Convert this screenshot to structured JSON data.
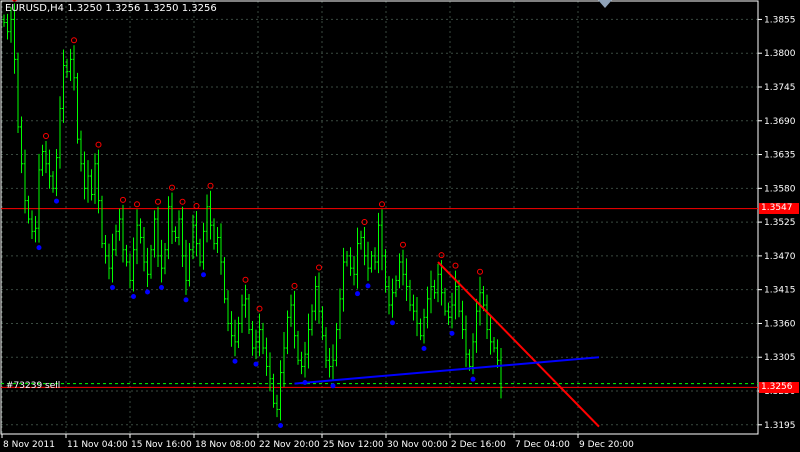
{
  "window": {
    "title": "EURUSD,H4  1.3250 1.3256 1.3250 1.3256",
    "order_label": "#73239 sell"
  },
  "colors": {
    "background": "#000000",
    "grid": "#3a4a40",
    "axis": "#ffffff",
    "candle": "#00ff00",
    "fractal_up": "#ff0000",
    "fractal_down": "#0000ff",
    "hline": "#ff0000",
    "trend_down": "#ff0000",
    "trend_up": "#0000ff",
    "order_line": "#00ff00"
  },
  "chart_data": {
    "type": "candlestick",
    "symbol": "EURUSD",
    "timeframe": "H4",
    "ohlc_header": "1.3250 1.3256 1.3250 1.3256",
    "ylim": [
      1.318,
      1.3885
    ],
    "y_ticks": [
      "1.3855",
      "1.3800",
      "1.3745",
      "1.3690",
      "1.3635",
      "1.3580",
      "1.3525",
      "1.3470",
      "1.3415",
      "1.3360",
      "1.3305",
      "1.3250",
      "1.3195"
    ],
    "x_ticks": [
      "8 Nov 2011",
      "11 Nov 04:00",
      "15 Nov 16:00",
      "18 Nov 08:00",
      "22 Nov 20:00",
      "25 Nov 12:00",
      "30 Nov 00:00",
      "2 Dec 16:00",
      "7 Dec 04:00",
      "9 Dec 20:00"
    ],
    "closes": [
      1.385,
      1.3835,
      1.3855,
      1.379,
      1.368,
      1.362,
      1.356,
      1.353,
      1.351,
      1.3515,
      1.361,
      1.364,
      1.362,
      1.36,
      1.358,
      1.363,
      1.371,
      1.378,
      1.377,
      1.379,
      1.376,
      1.366,
      1.362,
      1.358,
      1.36,
      1.357,
      1.362,
      1.356,
      1.349,
      1.347,
      1.345,
      1.348,
      1.351,
      1.353,
      1.348,
      1.346,
      1.343,
      1.348,
      1.352,
      1.35,
      1.346,
      1.344,
      1.348,
      1.353,
      1.347,
      1.345,
      1.348,
      1.355,
      1.351,
      1.35,
      1.353,
      1.347,
      1.343,
      1.348,
      1.352,
      1.349,
      1.346,
      1.351,
      1.355,
      1.352,
      1.349,
      1.35,
      1.346,
      1.34,
      1.336,
      1.334,
      1.333,
      1.336,
      1.339,
      1.34,
      1.335,
      1.332,
      1.333,
      1.335,
      1.332,
      1.329,
      1.327,
      1.323,
      1.322,
      1.328,
      1.332,
      1.337,
      1.339,
      1.334,
      1.33,
      1.329,
      1.331,
      1.335,
      1.338,
      1.342,
      1.338,
      1.334,
      1.33,
      1.329,
      1.33,
      1.335,
      1.34,
      1.346,
      1.347,
      1.345,
      1.344,
      1.349,
      1.35,
      1.347,
      1.345,
      1.347,
      1.346,
      1.352,
      1.347,
      1.342,
      1.339,
      1.341,
      1.343,
      1.346,
      1.344,
      1.342,
      1.339,
      1.338,
      1.336,
      1.334,
      1.337,
      1.34,
      1.342,
      1.341,
      1.344,
      1.341,
      1.338,
      1.337,
      1.339,
      1.342,
      1.338,
      1.335,
      1.331,
      1.329,
      1.333,
      1.338,
      1.341,
      1.339,
      1.335,
      1.333,
      1.332,
      1.33,
      1.3256
    ],
    "hlines": [
      {
        "price": 1.3547,
        "label": "1.3547"
      },
      {
        "price": 1.3256,
        "label": "1.3256"
      }
    ],
    "order_line": {
      "price": 1.3262,
      "label": "#73239 sell"
    },
    "trendlines": [
      {
        "name": "down",
        "from_bar": 124,
        "from_price": 1.346,
        "to_bar": 170,
        "to_price": 1.3192
      },
      {
        "name": "up",
        "from_bar": 83,
        "from_price": 1.3262,
        "to_bar": 170,
        "to_price": 1.3305
      }
    ],
    "grid": true
  }
}
